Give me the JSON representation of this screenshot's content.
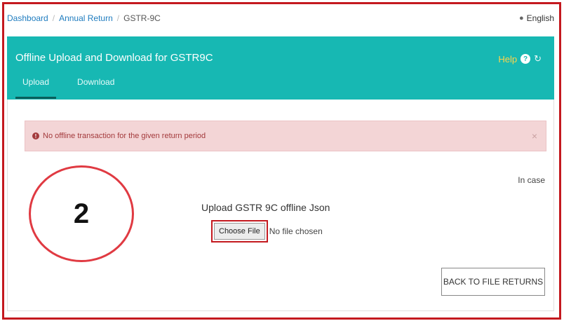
{
  "breadcrumb": {
    "items": [
      "Dashboard",
      "Annual Return",
      "GSTR-9C"
    ],
    "separator": "/"
  },
  "language": {
    "icon": "globe-icon",
    "label": "English"
  },
  "header": {
    "title": "Offline Upload and Download for GSTR9C",
    "help_label": "Help",
    "help_icon": "?",
    "refresh_icon": "↻",
    "tabs": [
      {
        "label": "Upload",
        "active": true
      },
      {
        "label": "Download",
        "active": false
      }
    ],
    "color": "#17b8b3"
  },
  "alert": {
    "icon": "!",
    "message": "No offline transaction for the given return period",
    "close": "×",
    "color": "#f3d5d6"
  },
  "side_note": "In case",
  "upload": {
    "title": "Upload GSTR 9C offline Json",
    "choose_label": "Choose File",
    "status": "No file chosen"
  },
  "back_button": "BACK TO FILE RETURNS",
  "annotation": {
    "step_number": "2",
    "color": "#e03a42"
  }
}
